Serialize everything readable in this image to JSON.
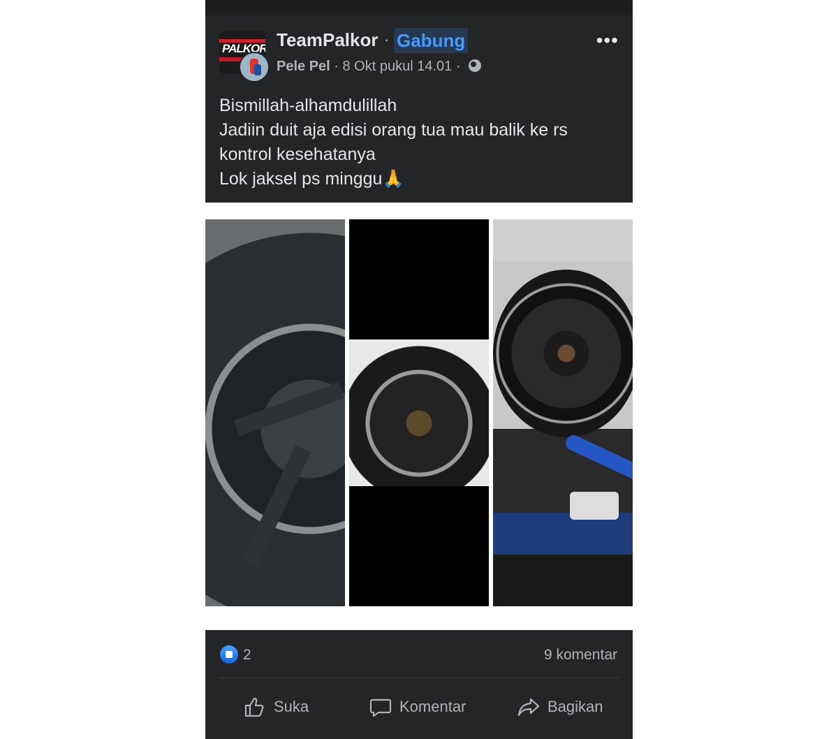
{
  "group": {
    "name": "TeamPalkor",
    "separator": "·",
    "join_label": "Gabung"
  },
  "author": {
    "name": "Pele Pel",
    "timestamp": "8 Okt pukul 14.01",
    "privacy_icon": "globe-icon"
  },
  "post": {
    "lines": [
      "Bismillah-alhamdulillah",
      "Jadiin duit aja edisi orang tua mau balik ke rs",
      "kontrol kesehatanya",
      "Lok jaksel ps minggu🙏"
    ]
  },
  "reactions": {
    "count": "2",
    "comments": "9 komentar"
  },
  "actions": {
    "like": "Suka",
    "comment": "Komentar",
    "share": "Bagikan"
  },
  "colors": {
    "background": "#242526",
    "accent": "#4599ff",
    "text": "#e4e6eb",
    "muted": "#b0b3b8"
  }
}
